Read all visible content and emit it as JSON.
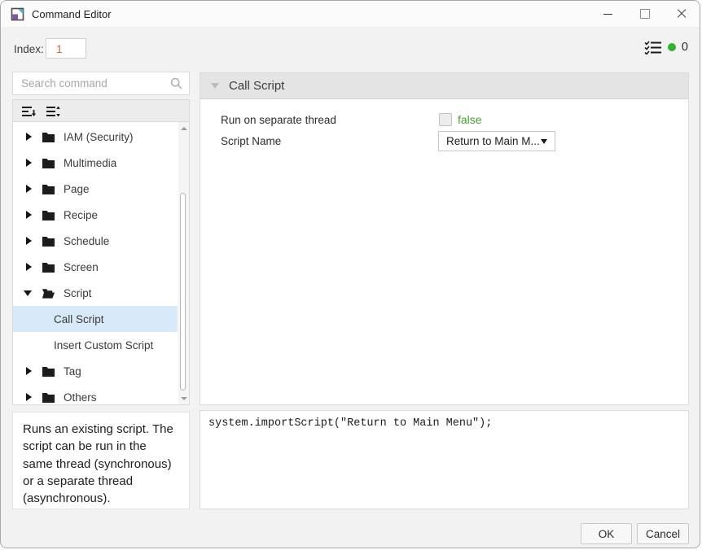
{
  "window": {
    "title": "Command Editor"
  },
  "icons": [
    "app-logo-icon",
    "minimize-icon",
    "maximize-icon",
    "close-icon",
    "search-icon",
    "collapse-all-icon",
    "expand-all-icon",
    "tasklist-icon",
    "status-dot",
    "folder-icon",
    "folder-open-icon",
    "chevron-right-icon",
    "chevron-down-icon",
    "dropdown-caret-icon",
    "scroll-up-icon",
    "scroll-down-icon"
  ],
  "index": {
    "label": "Index:",
    "value": "1"
  },
  "status": {
    "count": "0",
    "dot_color": "#2eb52e"
  },
  "search": {
    "placeholder": "Search command"
  },
  "left_panel": {
    "tree": {
      "items": [
        {
          "label": "IAM (Security)",
          "type": "folder",
          "state": "collapsed"
        },
        {
          "label": "Multimedia",
          "type": "folder",
          "state": "collapsed"
        },
        {
          "label": "Page",
          "type": "folder",
          "state": "collapsed"
        },
        {
          "label": "Recipe",
          "type": "folder",
          "state": "collapsed"
        },
        {
          "label": "Schedule",
          "type": "folder",
          "state": "collapsed"
        },
        {
          "label": "Screen",
          "type": "folder",
          "state": "collapsed"
        },
        {
          "label": "Script",
          "type": "folder",
          "state": "expanded"
        },
        {
          "label": "Call Script",
          "type": "leaf",
          "selected": true
        },
        {
          "label": "Insert Custom Script",
          "type": "leaf",
          "selected": false
        },
        {
          "label": "Tag",
          "type": "folder",
          "state": "collapsed"
        },
        {
          "label": "Others",
          "type": "folder",
          "state": "collapsed"
        }
      ]
    },
    "description": "Runs an existing script. The script can be run in the same thread (synchronous) or a separate thread (asynchronous)."
  },
  "right_panel": {
    "header": "Call Script",
    "fields": [
      {
        "label": "Run on separate thread",
        "control": "checkbox",
        "value": "false",
        "checked": false
      },
      {
        "label": "Script Name",
        "control": "dropdown",
        "value": "Return to Main M..."
      }
    ],
    "code": "system.importScript(\"Return to Main Menu\");"
  },
  "footer": {
    "ok": "OK",
    "cancel": "Cancel"
  },
  "colors": {
    "selection": "#d8eafa",
    "value_green": "#44a12b",
    "index_orange": "#cf6a33",
    "header_gray": "#e4e4e4",
    "status_green": "#2eb52e"
  }
}
